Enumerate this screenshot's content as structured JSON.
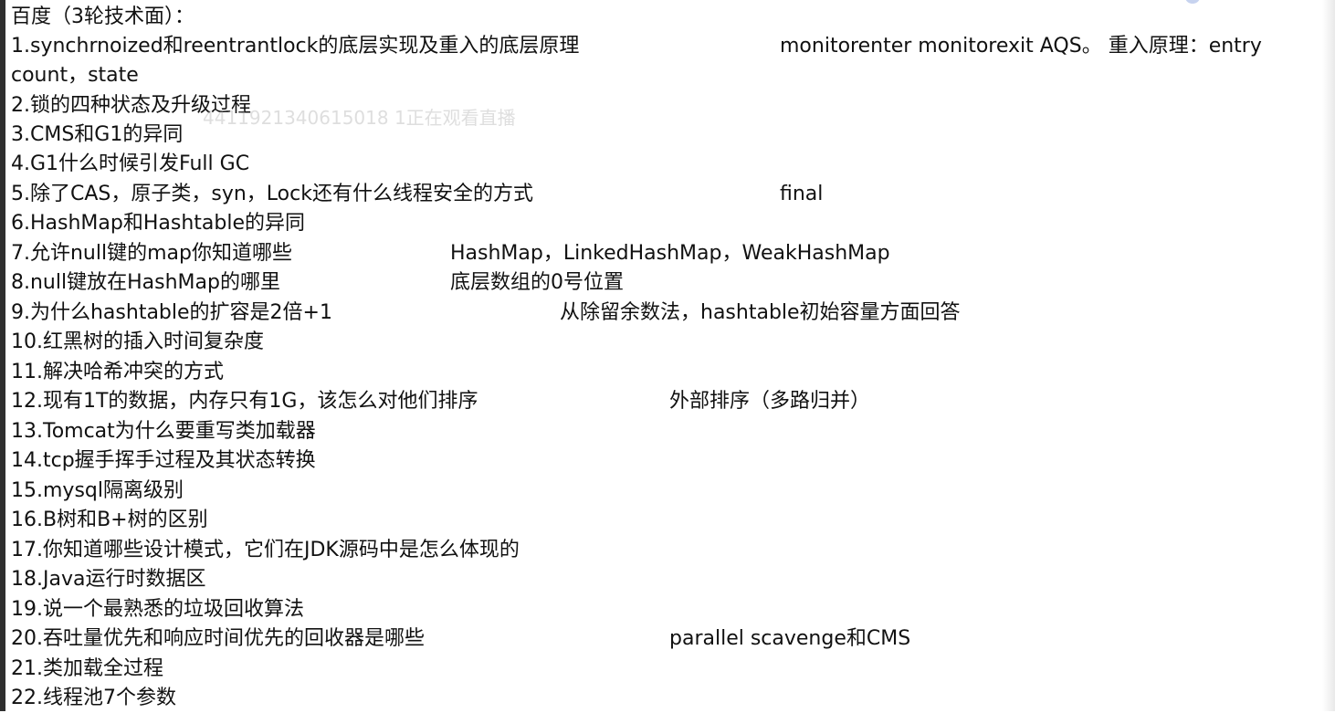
{
  "title": "百度（3轮技术面）：",
  "watermark": "4411921340615018 1正在观看直播",
  "q1": {
    "q": "1.synchrnoized和reentrantlock的底层实现及重入的底层原理",
    "a": "monitorenter monitorexit AQS。 重入原理：entry",
    "cont": "count，state"
  },
  "q2": {
    "q": "2.锁的四种状态及升级过程"
  },
  "q3": {
    "q": "3.CMS和G1的异同"
  },
  "q4": {
    "q": "4.G1什么时候引发Full GC"
  },
  "q5": {
    "q": "5.除了CAS，原子类，syn，Lock还有什么线程安全的方式",
    "a": "final"
  },
  "q6": {
    "q": "6.HashMap和Hashtable的异同"
  },
  "q7": {
    "q": "7.允许null键的map你知道哪些",
    "a": "HashMap，LinkedHashMap，WeakHashMap"
  },
  "q8": {
    "q": "8.null键放在HashMap的哪里",
    "a": "底层数组的0号位置"
  },
  "q9": {
    "q": "9.为什么hashtable的扩容是2倍+1",
    "a": "从除留余数法，hashtable初始容量方面回答"
  },
  "q10": {
    "q": "10.红黑树的插入时间复杂度"
  },
  "q11": {
    "q": "11.解决哈希冲突的方式"
  },
  "q12": {
    "q": "12.现有1T的数据，内存只有1G，该怎么对他们排序",
    "a": "外部排序（多路归并）"
  },
  "q13": {
    "q": "13.Tomcat为什么要重写类加载器"
  },
  "q14": {
    "q": "14.tcp握手挥手过程及其状态转换"
  },
  "q15": {
    "q": "15.mysql隔离级别"
  },
  "q16": {
    "q": "16.B树和B+树的区别"
  },
  "q17": {
    "q": "17.你知道哪些设计模式，它们在JDK源码中是怎么体现的"
  },
  "q18": {
    "q": "18.Java运行时数据区"
  },
  "q19": {
    "q": "19.说一个最熟悉的垃圾回收算法"
  },
  "q20": {
    "q": "20.吞吐量优先和响应时间优先的回收器是哪些",
    "a": "parallel scavenge和CMS"
  },
  "q21": {
    "q": "21.类加载全过程"
  },
  "q22": {
    "q": "22.线程池7个参数"
  }
}
